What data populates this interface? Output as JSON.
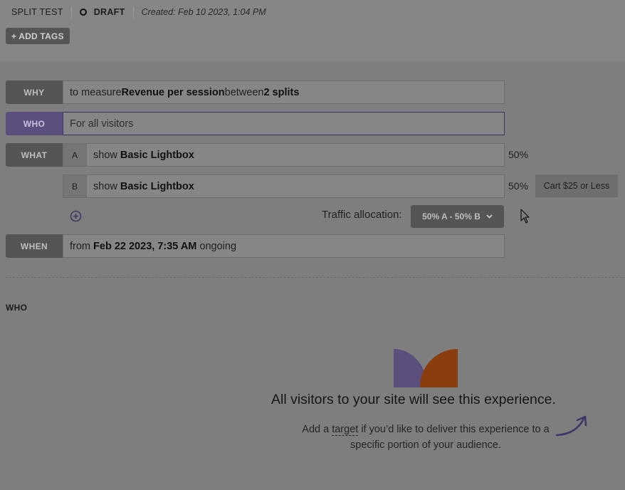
{
  "header": {
    "experience_type": "SPLIT TEST",
    "status": "DRAFT",
    "created": "Created: Feb 10 2023, 1:04 PM",
    "add_tags_label": "+ ADD TAGS"
  },
  "why": {
    "label": "WHY",
    "text_1": "to measure ",
    "metric": "Revenue per session",
    "text_2": " between ",
    "splits": "2 splits"
  },
  "who": {
    "label": "WHO",
    "text": "For all visitors"
  },
  "what": {
    "label": "WHAT",
    "variants": [
      {
        "letter": "A",
        "prefix": "show ",
        "name": "Basic Lightbox",
        "percent": "50%"
      },
      {
        "letter": "B",
        "prefix": "show ",
        "name": "Basic Lightbox",
        "percent": "50%",
        "badge": "Cart $25 or Less"
      }
    ],
    "traffic_label": "Traffic allocation:",
    "traffic_value": "50% A - 50% B"
  },
  "when": {
    "label": "WHEN",
    "prefix": "from ",
    "date": "Feb 22 2023, 7:35 AM",
    "suffix": " ongoing"
  },
  "who_section": {
    "title": "WHO",
    "empty_title": "All visitors to your site will see this experience.",
    "desc_1": "Add a ",
    "desc_link": "target",
    "desc_2": " if you’d like to deliver this experience to a specific portion of your audience."
  },
  "colors": {
    "accent_purple": "#5b4f7e",
    "accent_orange": "#8a3e0e"
  }
}
